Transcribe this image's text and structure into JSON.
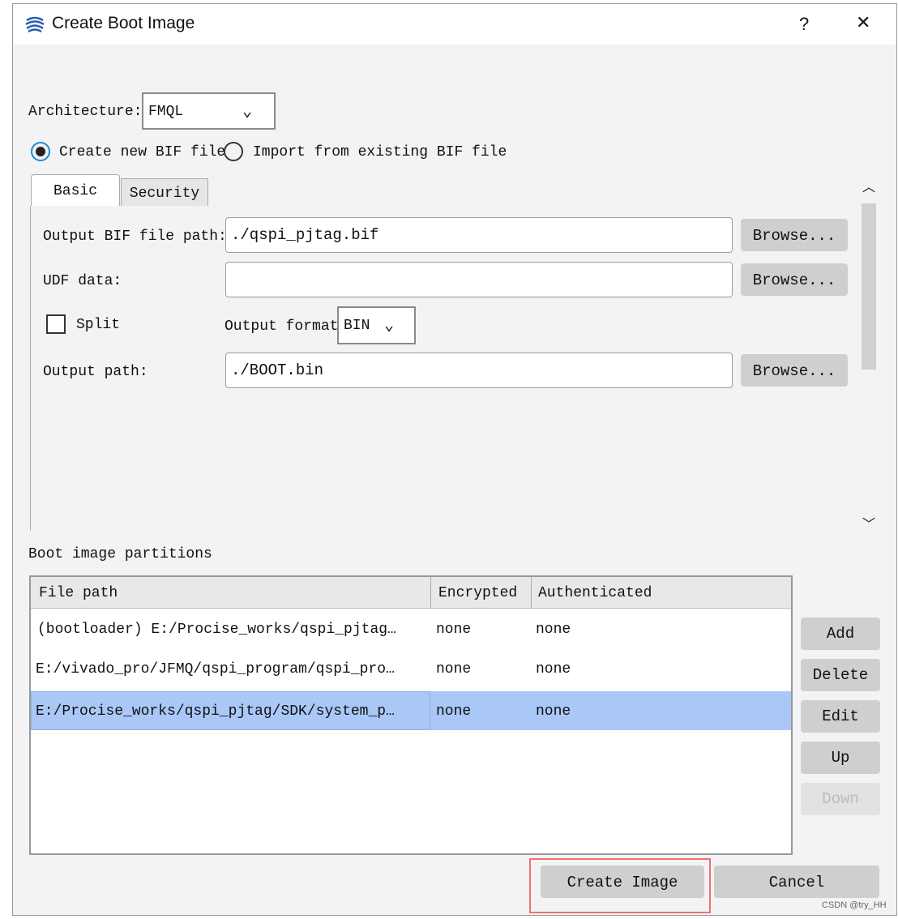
{
  "window": {
    "title": "Create Boot Image",
    "help": "?",
    "close": "✕"
  },
  "architecture": {
    "label": "Architecture:",
    "value": "FMQL"
  },
  "bif_mode": {
    "create_label": "Create new BIF file",
    "import_label": "Import from existing BIF file",
    "selected": "create"
  },
  "tabs": [
    {
      "label": "Basic",
      "active": true
    },
    {
      "label": "Security",
      "active": false
    }
  ],
  "basic": {
    "output_bif_label": "Output BIF file path:",
    "output_bif_value": "./qspi_pjtag.bif",
    "udf_label": "UDF data:",
    "udf_value": "",
    "split_label": "Split",
    "split_checked": false,
    "output_format_label": "Output format",
    "output_format_value": "BIN",
    "output_path_label": "Output path:",
    "output_path_value": "./BOOT.bin",
    "browse": "Browse..."
  },
  "partitions": {
    "label": "Boot image partitions",
    "columns": [
      "File path",
      "Encrypted",
      "Authenticated"
    ],
    "rows": [
      {
        "path": "(bootloader) E:/Procise_works/qspi_pjtag…",
        "enc": "none",
        "auth": "none"
      },
      {
        "path": "E:/vivado_pro/JFMQ/qspi_program/qspi_pro…",
        "enc": "none",
        "auth": "none"
      },
      {
        "path": "E:/Procise_works/qspi_pjtag/SDK/system_p…",
        "enc": "none",
        "auth": "none",
        "selected": true
      }
    ],
    "buttons": {
      "add": "Add",
      "delete": "Delete",
      "edit": "Edit",
      "up": "Up",
      "down": "Down"
    }
  },
  "footer": {
    "create": "Create Image",
    "cancel": "Cancel"
  },
  "watermark": "CSDN @try_HH",
  "colors": {
    "selection": "#a9c8f7",
    "highlight_box": "#f07070",
    "radio_accent": "#1a8ad4"
  }
}
